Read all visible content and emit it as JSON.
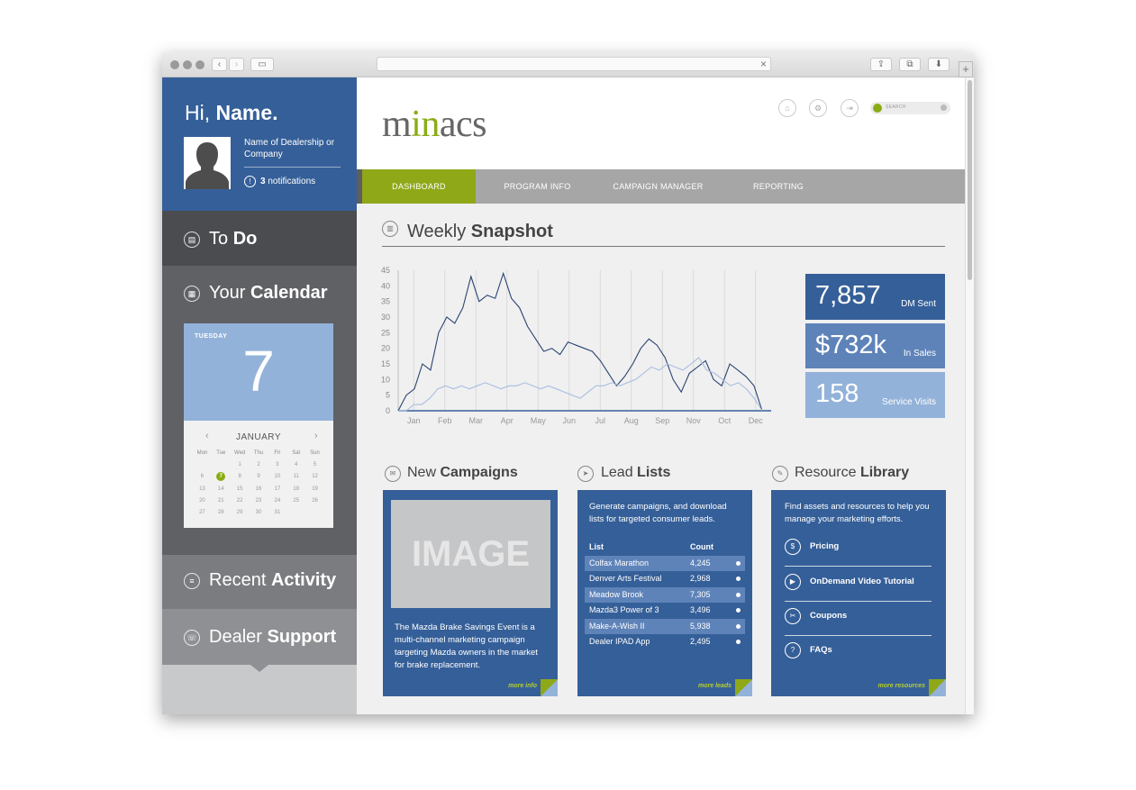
{
  "greeting": {
    "hi": "Hi,",
    "name": "Name."
  },
  "dealer_name": "Name of Dealership or Company",
  "notifications": {
    "count": "3",
    "label": "notifications"
  },
  "sidebar_sections": {
    "todo": {
      "light": "To",
      "bold": "Do"
    },
    "calendar": {
      "light": "Your",
      "bold": "Calendar"
    },
    "recent": {
      "light": "Recent",
      "bold": "Activity"
    },
    "support": {
      "light": "Dealer",
      "bold": "Support"
    }
  },
  "calendar": {
    "weekday": "TUESDAY",
    "day": "7",
    "month": "JANUARY",
    "day_headers": [
      "Mon",
      "Tue",
      "Wed",
      "Thu",
      "Fri",
      "Sat",
      "Sun"
    ],
    "leading_blank": 2,
    "days_in_month": 31,
    "selected": 7
  },
  "logo": {
    "part1": "m",
    "part2": "in",
    "part3": "acs"
  },
  "search": {
    "placeholder": "SEARCH"
  },
  "nav": [
    "DASHBOARD",
    "PROGRAM INFO",
    "CAMPAIGN MANAGER",
    "REPORTING"
  ],
  "snapshot": {
    "light": "Weekly",
    "bold": "Snapshot"
  },
  "stats": [
    {
      "value": "7,857",
      "label": "DM Sent",
      "color": "#355f98"
    },
    {
      "value": "$732k",
      "label": "In Sales",
      "color": "#5e83b9"
    },
    {
      "value": "158",
      "label": "Service Visits",
      "color": "#93b2d9"
    }
  ],
  "chart_data": {
    "type": "line",
    "x_labels": [
      "Jan",
      "Feb",
      "Mar",
      "Apr",
      "May",
      "Jun",
      "Jul",
      "Aug",
      "Sep",
      "Nov",
      "Oct",
      "Dec"
    ],
    "ylim": [
      0,
      45
    ],
    "y_ticks": [
      0,
      5,
      10,
      15,
      20,
      25,
      30,
      35,
      40,
      45
    ],
    "series": [
      {
        "color": "#2a4470",
        "values": [
          0,
          5,
          7,
          15,
          13,
          25,
          30,
          28,
          33,
          43,
          35,
          37,
          36,
          44,
          36,
          33,
          27,
          23,
          19,
          20,
          18,
          22,
          21,
          20,
          19,
          16,
          12,
          8,
          11,
          15,
          20,
          23,
          21,
          17,
          10,
          6,
          12,
          14,
          16,
          10,
          8,
          15,
          13,
          11,
          8,
          0
        ]
      },
      {
        "color": "#a9bde0",
        "values": [
          0,
          0,
          2,
          2,
          4,
          7,
          8,
          7,
          8,
          7,
          8,
          9,
          8,
          7,
          8,
          8,
          9,
          8,
          7,
          8,
          7,
          6,
          5,
          4,
          6,
          8,
          8,
          9,
          8,
          9,
          10,
          12,
          14,
          13,
          15,
          14,
          13,
          15,
          17,
          13,
          12,
          10,
          8,
          9,
          7,
          4,
          0
        ]
      }
    ]
  },
  "campaigns": {
    "heading_light": "New",
    "heading_bold": "Campaigns",
    "image_label": "IMAGE",
    "text": "The Mazda Brake Savings Event is a multi-channel marketing campaign targeting Mazda owners in the market for brake replacement.",
    "more": "more info"
  },
  "leads": {
    "heading_light": "Lead",
    "heading_bold": "Lists",
    "intro": "Generate campaigns, and download lists for targeted consumer leads.",
    "col_list": "List",
    "col_count": "Count",
    "rows": [
      {
        "name": "Colfax Marathon",
        "count": "4,245"
      },
      {
        "name": "Denver Arts Festival",
        "count": "2,968"
      },
      {
        "name": "Meadow Brook",
        "count": "7,305"
      },
      {
        "name": "Mazda3 Power of 3",
        "count": "3,496"
      },
      {
        "name": "Make-A-Wish II",
        "count": "5,938"
      },
      {
        "name": "Dealer IPAD App",
        "count": "2,495"
      }
    ],
    "more": "more leads"
  },
  "resources": {
    "heading_light": "Resource",
    "heading_bold": "Library",
    "intro": "Find assets and resources to help you manage your marketing efforts.",
    "items": [
      "Pricing",
      "OnDemand Video Tutorial",
      "Coupons",
      "FAQs"
    ],
    "more": "more resources"
  }
}
